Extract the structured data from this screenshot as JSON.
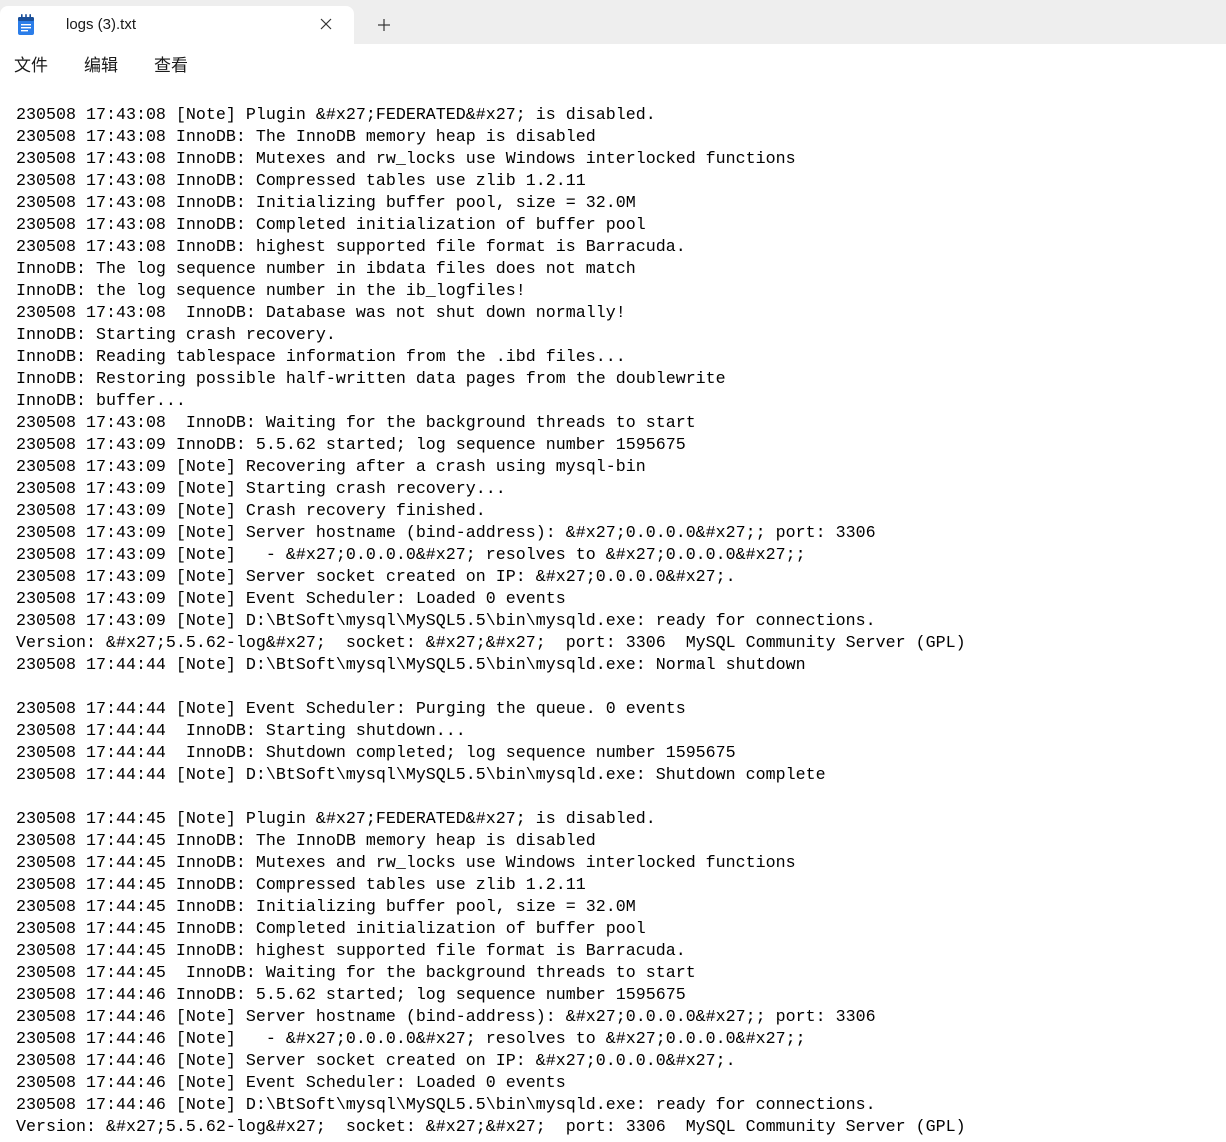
{
  "tab": {
    "title": "logs (3).txt",
    "icon": "notepad-icon",
    "close_icon": "close-icon"
  },
  "new_tab": {
    "icon": "plus-icon"
  },
  "menu": {
    "items": [
      {
        "label": "文件"
      },
      {
        "label": "编辑"
      },
      {
        "label": "查看"
      }
    ]
  },
  "editor": {
    "lines": [
      "230508 17:43:08 [Note] Plugin &#x27;FEDERATED&#x27; is disabled.",
      "230508 17:43:08 InnoDB: The InnoDB memory heap is disabled",
      "230508 17:43:08 InnoDB: Mutexes and rw_locks use Windows interlocked functions",
      "230508 17:43:08 InnoDB: Compressed tables use zlib 1.2.11",
      "230508 17:43:08 InnoDB: Initializing buffer pool, size = 32.0M",
      "230508 17:43:08 InnoDB: Completed initialization of buffer pool",
      "230508 17:43:08 InnoDB: highest supported file format is Barracuda.",
      "InnoDB: The log sequence number in ibdata files does not match",
      "InnoDB: the log sequence number in the ib_logfiles!",
      "230508 17:43:08  InnoDB: Database was not shut down normally!",
      "InnoDB: Starting crash recovery.",
      "InnoDB: Reading tablespace information from the .ibd files...",
      "InnoDB: Restoring possible half-written data pages from the doublewrite",
      "InnoDB: buffer...",
      "230508 17:43:08  InnoDB: Waiting for the background threads to start",
      "230508 17:43:09 InnoDB: 5.5.62 started; log sequence number 1595675",
      "230508 17:43:09 [Note] Recovering after a crash using mysql-bin",
      "230508 17:43:09 [Note] Starting crash recovery...",
      "230508 17:43:09 [Note] Crash recovery finished.",
      "230508 17:43:09 [Note] Server hostname (bind-address): &#x27;0.0.0.0&#x27;; port: 3306",
      "230508 17:43:09 [Note]   - &#x27;0.0.0.0&#x27; resolves to &#x27;0.0.0.0&#x27;;",
      "230508 17:43:09 [Note] Server socket created on IP: &#x27;0.0.0.0&#x27;.",
      "230508 17:43:09 [Note] Event Scheduler: Loaded 0 events",
      "230508 17:43:09 [Note] D:\\BtSoft\\mysql\\MySQL5.5\\bin\\mysqld.exe: ready for connections.",
      "Version: &#x27;5.5.62-log&#x27;  socket: &#x27;&#x27;  port: 3306  MySQL Community Server (GPL)",
      "230508 17:44:44 [Note] D:\\BtSoft\\mysql\\MySQL5.5\\bin\\mysqld.exe: Normal shutdown",
      "",
      "230508 17:44:44 [Note] Event Scheduler: Purging the queue. 0 events",
      "230508 17:44:44  InnoDB: Starting shutdown...",
      "230508 17:44:44  InnoDB: Shutdown completed; log sequence number 1595675",
      "230508 17:44:44 [Note] D:\\BtSoft\\mysql\\MySQL5.5\\bin\\mysqld.exe: Shutdown complete",
      "",
      "230508 17:44:45 [Note] Plugin &#x27;FEDERATED&#x27; is disabled.",
      "230508 17:44:45 InnoDB: The InnoDB memory heap is disabled",
      "230508 17:44:45 InnoDB: Mutexes and rw_locks use Windows interlocked functions",
      "230508 17:44:45 InnoDB: Compressed tables use zlib 1.2.11",
      "230508 17:44:45 InnoDB: Initializing buffer pool, size = 32.0M",
      "230508 17:44:45 InnoDB: Completed initialization of buffer pool",
      "230508 17:44:45 InnoDB: highest supported file format is Barracuda.",
      "230508 17:44:45  InnoDB: Waiting for the background threads to start",
      "230508 17:44:46 InnoDB: 5.5.62 started; log sequence number 1595675",
      "230508 17:44:46 [Note] Server hostname (bind-address): &#x27;0.0.0.0&#x27;; port: 3306",
      "230508 17:44:46 [Note]   - &#x27;0.0.0.0&#x27; resolves to &#x27;0.0.0.0&#x27;;",
      "230508 17:44:46 [Note] Server socket created on IP: &#x27;0.0.0.0&#x27;.",
      "230508 17:44:46 [Note] Event Scheduler: Loaded 0 events",
      "230508 17:44:46 [Note] D:\\BtSoft\\mysql\\MySQL5.5\\bin\\mysqld.exe: ready for connections.",
      "Version: &#x27;5.5.62-log&#x27;  socket: &#x27;&#x27;  port: 3306  MySQL Community Server (GPL)"
    ]
  },
  "colors": {
    "tab_bar_bg": "#eeeeee",
    "active_tab_bg": "#ffffff",
    "editor_bg": "#ffffff",
    "text": "#000000",
    "app_icon_blue": "#2b7de9",
    "app_icon_dark": "#1a4f99"
  }
}
